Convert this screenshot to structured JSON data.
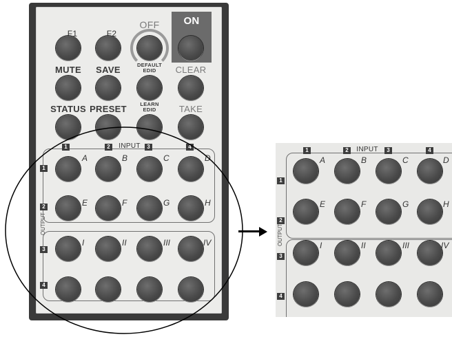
{
  "remote": {
    "f1": "F1",
    "f2": "F2",
    "off": "OFF",
    "on": "ON",
    "mute": "MUTE",
    "save": "SAVE",
    "default_edid": "DEFAULT\nEDID",
    "clear": "CLEAR",
    "status": "STATUS",
    "preset": "PRESET",
    "learn_edid": "LEARN\nEDID",
    "take": "TAKE",
    "input_label": "INPUT",
    "output_label": "OUTPUT",
    "inputs": [
      "1",
      "2",
      "3",
      "4"
    ],
    "outputs": [
      "1",
      "2",
      "3",
      "4"
    ],
    "letters_row1": [
      "A",
      "B",
      "C",
      "D"
    ],
    "letters_row2": [
      "E",
      "F",
      "G",
      "H"
    ],
    "letters_row3": [
      "I",
      "II",
      "III",
      "IV"
    ]
  },
  "colors": {
    "body": "#3a3a3a",
    "face": "#ececea",
    "button": "#4a4a4a",
    "on_panel": "#6b6b6b",
    "annotation": "#000000"
  }
}
